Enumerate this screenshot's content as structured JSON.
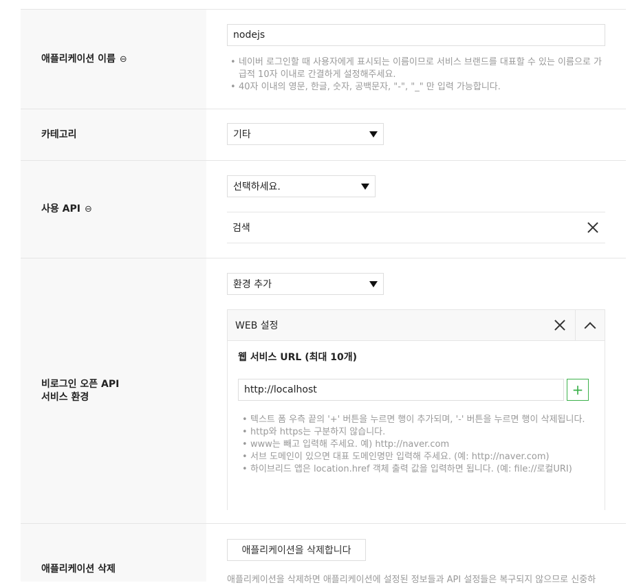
{
  "app_name": {
    "label": "애플리케이션 이름",
    "value": "nodejs",
    "help": [
      "네이버 로그인할 때 사용자에게 표시되는 이름이므로 서비스 브랜드를 대표할 수 있는 이름으로 가급적 10자 이내로 간결하게 설정해주세요.",
      "40자 이내의 영문, 한글, 숫자, 공백문자, \"-\", \"_\" 만 입력 가능합니다."
    ]
  },
  "category": {
    "label": "카테고리",
    "selected": "기타"
  },
  "api": {
    "label": "사용 API",
    "selected": "선택하세요.",
    "items": [
      "검색"
    ]
  },
  "environment": {
    "label_line1": "비로그인 오픈 API",
    "label_line2": "서비스 환경",
    "selected": "환경 추가",
    "web": {
      "title": "WEB 설정",
      "url_heading": "웹 서비스 URL (최대 10개)",
      "url_value": "http://localhost",
      "add_symbol": "+",
      "help": [
        "텍스트 폼 우측 끝의 '+' 버튼을 누르면 행이 추가되며, '-' 버튼을 누르면 행이 삭제됩니다.",
        "http와 https는 구분하지 않습니다.",
        "www는 빼고 입력해 주세요. 예) http://naver.com",
        "서브 도메인이 있으면 대표 도메인명만 입력해 주세요. (예: http://naver.com)",
        "하이브리드 앱은 location.href 객체 출력 값을 입력하면 됩니다. (예: file://로컬URI)"
      ]
    }
  },
  "delete": {
    "label": "애플리케이션 삭제",
    "button": "애플리케이션을 삭제합니다",
    "help": "애플리케이션을 삭제하면 애플리케이션에 설정된 정보들과 API 설정들은 복구되지 않으므로 신중하"
  },
  "icons": {
    "link": "link-icon",
    "caret": "caret-down-icon",
    "close": "close-icon",
    "collapse": "chevron-up-icon",
    "plus": "plus-icon"
  }
}
